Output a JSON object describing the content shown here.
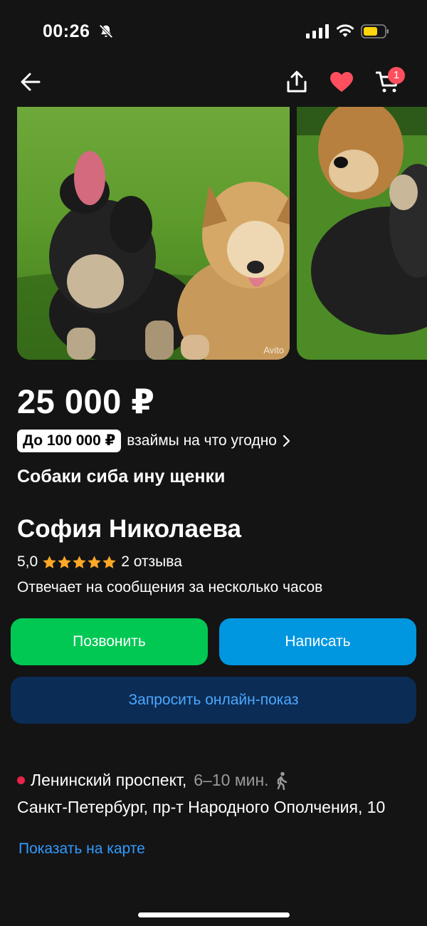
{
  "status_bar": {
    "time": "00:26"
  },
  "nav": {
    "cart_count": "1"
  },
  "gallery": {
    "watermark": "Avito"
  },
  "listing": {
    "price": "25 000 ₽",
    "loan_badge": "До 100 000 ₽",
    "loan_text": "взаймы на что угодно",
    "title": "Собаки сиба ину щенки"
  },
  "seller": {
    "name": "София Николаева",
    "rating": "5,0",
    "stars": 5,
    "reviews": "2 отзыва",
    "response_time": "Отвечает на сообщения за несколько часов"
  },
  "actions": {
    "call": "Позвонить",
    "write": "Написать",
    "online_show": "Запросить онлайн-показ"
  },
  "location": {
    "metro": "Ленинский проспект,",
    "metro_time": "6–10 мин.",
    "address": "Санкт-Петербург, пр-т Народного Ополчения, 10",
    "map_link": "Показать на карте"
  },
  "colors": {
    "background": "#141414",
    "call_button": "#00c853",
    "write_button": "#0096e0",
    "online_button": "#0b2c55",
    "favorite": "#ff4f5f",
    "star": "#ffa726",
    "metro_dot": "#e8234a",
    "link": "#2f9bff"
  },
  "icons": [
    "bell-muted-icon",
    "signal-icon",
    "wifi-icon",
    "battery-icon",
    "back-arrow-icon",
    "share-icon",
    "heart-icon",
    "cart-icon",
    "chevron-right-icon",
    "star-icon",
    "walk-icon"
  ]
}
